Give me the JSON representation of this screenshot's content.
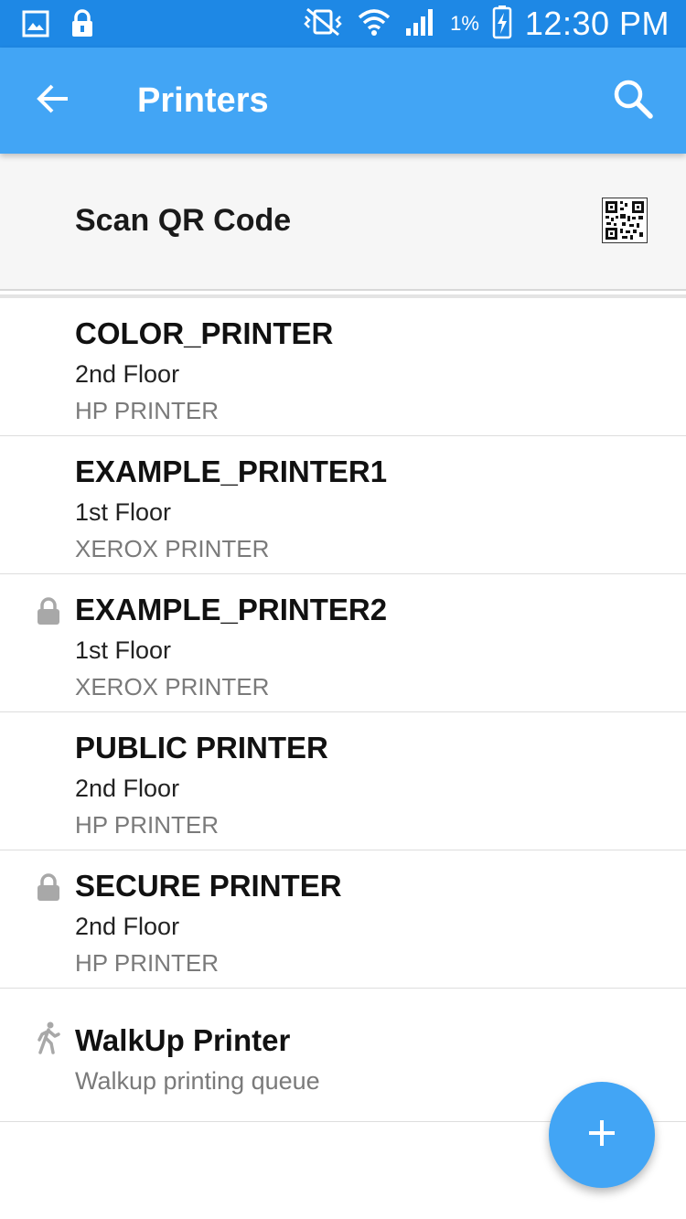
{
  "status_bar": {
    "battery_percent": "1%",
    "time": "12:30 PM",
    "icons": [
      "gallery-icon",
      "lock-icon",
      "vibrate-mute-icon",
      "wifi-icon",
      "signal-icon",
      "battery-charging-icon"
    ]
  },
  "app_bar": {
    "title": "Printers",
    "back_icon": "arrow-back-icon",
    "search_icon": "search-icon"
  },
  "qr": {
    "label": "Scan QR Code",
    "icon": "qr-code-icon"
  },
  "printers": [
    {
      "name": "COLOR_PRINTER",
      "location": "2nd Floor",
      "model": "HP PRINTER",
      "icon": ""
    },
    {
      "name": "EXAMPLE_PRINTER1",
      "location": "1st Floor",
      "model": "XEROX PRINTER",
      "icon": ""
    },
    {
      "name": "EXAMPLE_PRINTER2",
      "location": "1st Floor",
      "model": "XEROX PRINTER",
      "icon": "lock-icon"
    },
    {
      "name": "PUBLIC PRINTER",
      "location": "2nd Floor",
      "model": "HP PRINTER",
      "icon": ""
    },
    {
      "name": "SECURE PRINTER",
      "location": "2nd Floor",
      "model": "HP PRINTER",
      "icon": "lock-icon"
    },
    {
      "name": "WalkUp Printer",
      "location": "Walkup printing queue",
      "model": "",
      "icon": "walk-icon"
    }
  ],
  "fab": {
    "icon": "add-icon",
    "label": "+"
  },
  "colors": {
    "status_bar": "#1e88e5",
    "app_bar": "#42a5f5",
    "fab": "#42a5f5",
    "icon_gray": "#a8a8a8"
  }
}
